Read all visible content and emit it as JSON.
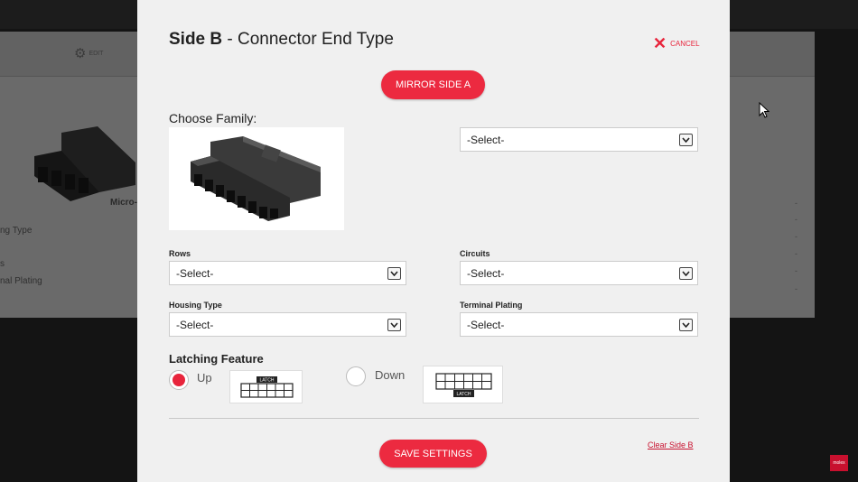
{
  "background": {
    "edit_label": "EDIT",
    "model_label": "Micro-",
    "side_labels": [
      "ng Type",
      "s",
      "nal Plating"
    ]
  },
  "modal": {
    "title_bold": "Side B",
    "title_rest": " - Connector End Type",
    "cancel_label": "CANCEL",
    "mirror_button": "MIRROR SIDE A",
    "choose_family_label": "Choose Family:",
    "family_select": "-Select-",
    "fields": {
      "rows": {
        "label": "Rows",
        "value": "-Select-"
      },
      "circuits": {
        "label": "Circuits",
        "value": "-Select-"
      },
      "housing_type": {
        "label": "Housing Type",
        "value": "-Select-"
      },
      "terminal_plating": {
        "label": "Terminal Plating",
        "value": "-Select-"
      }
    },
    "latching": {
      "title": "Latching Feature",
      "options": [
        {
          "label": "Up",
          "selected": true,
          "badge": "LATCH"
        },
        {
          "label": "Down",
          "selected": false,
          "badge": "LATCH"
        }
      ]
    },
    "save_button": "SAVE SETTINGS",
    "clear_link": "Clear Side B"
  },
  "brand_badge": "molex",
  "colors": {
    "accent": "#ec2a40",
    "modal_bg": "#f0f0f0",
    "overlay": "#141414"
  }
}
